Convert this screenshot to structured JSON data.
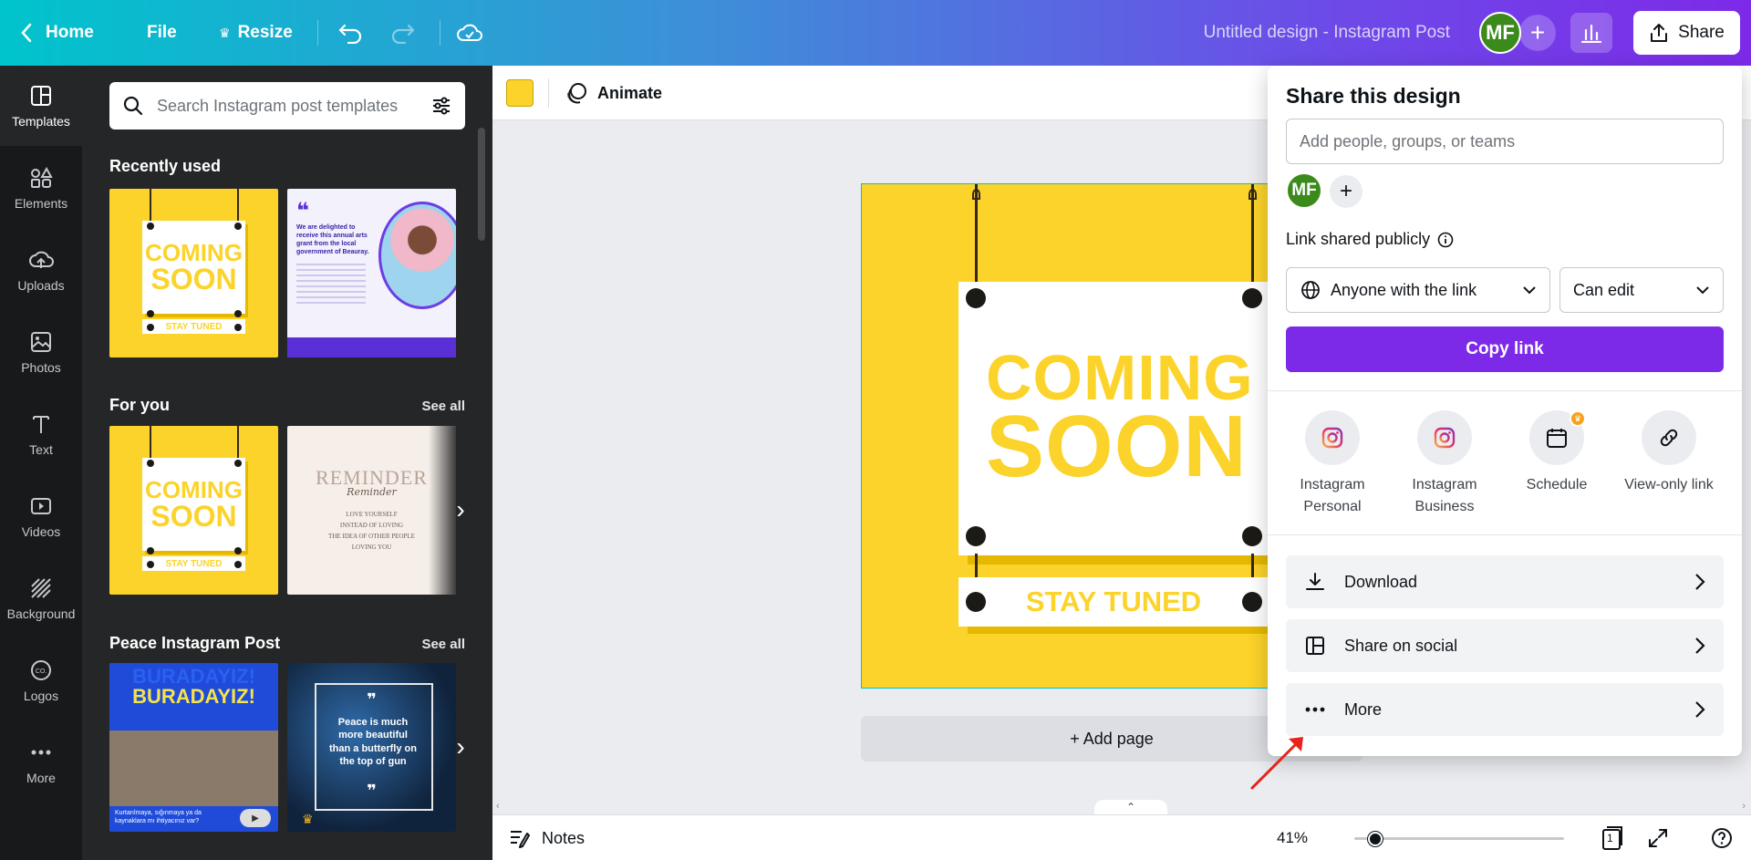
{
  "topbar": {
    "home": "Home",
    "file": "File",
    "resize": "Resize",
    "doc_title": "Untitled design - Instagram Post",
    "avatar_initials": "MF",
    "share": "Share"
  },
  "rail": {
    "items": [
      {
        "label": "Templates",
        "icon": "templates-icon"
      },
      {
        "label": "Elements",
        "icon": "elements-icon"
      },
      {
        "label": "Uploads",
        "icon": "upload-icon"
      },
      {
        "label": "Photos",
        "icon": "photo-icon"
      },
      {
        "label": "Text",
        "icon": "text-icon"
      },
      {
        "label": "Videos",
        "icon": "video-icon"
      },
      {
        "label": "Background",
        "icon": "background-icon"
      },
      {
        "label": "Logos",
        "icon": "logo-icon"
      },
      {
        "label": "More",
        "icon": "more-icon"
      }
    ]
  },
  "panel": {
    "search_placeholder": "Search Instagram post templates",
    "recently_used": "Recently used",
    "for_you": "For you",
    "peace": "Peace Instagram Post",
    "see_all": "See all",
    "thumb_cs": {
      "coming": "COMING",
      "soon": "SOON",
      "stay": "STAY TUNED"
    },
    "thumb_reminder": {
      "title": "REMINDER",
      "script": "Reminder",
      "lines": [
        "LOVE YOURSELF",
        "INSTEAD OF LOVING",
        "THE IDEA OF OTHER PEOPLE",
        "LOVING YOU"
      ]
    },
    "thumb_quote": {
      "text": "We are delighted to receive this annual arts grant from the local government of Beauray."
    },
    "thumb_burada": {
      "word": "BURADAYIZ!",
      "caption": "Kurtarılmaya, sığınmaya ya da kaynaklara mı ihtiyacınız var?"
    },
    "thumb_peace": {
      "text": "Peace is much more beautiful than a butterfly on the top of gun"
    }
  },
  "context_bar": {
    "color": "#fcd32a",
    "animate": "Animate"
  },
  "design": {
    "coming": "COMING",
    "soon": "SOON",
    "stay_tuned": "STAY TUNED",
    "bg_color": "#fcd32a"
  },
  "add_page": "+ Add page",
  "bottombar": {
    "notes": "Notes",
    "zoom": "41%",
    "zoom_level": 0.1,
    "page_count": "1"
  },
  "share_panel": {
    "title": "Share this design",
    "input_placeholder": "Add people, groups, or teams",
    "avatar_initials": "MF",
    "link_label": "Link shared publicly",
    "access": "Anyone with the link",
    "permission": "Can edit",
    "copy_link": "Copy link",
    "options": [
      {
        "label": "Instagram Personal",
        "icon": "instagram-icon"
      },
      {
        "label": "Instagram Business",
        "icon": "instagram-icon"
      },
      {
        "label": "Schedule",
        "icon": "calendar-icon"
      },
      {
        "label": "View-only link",
        "icon": "link-icon"
      }
    ],
    "rows": [
      {
        "label": "Download",
        "icon": "download-icon"
      },
      {
        "label": "Share on social",
        "icon": "share-social-icon"
      },
      {
        "label": "More",
        "icon": "more-dots-icon"
      }
    ]
  },
  "colors": {
    "brand_purple": "#7d2ae8",
    "accent_teal": "#00c4cc",
    "design_yellow": "#fcd32a"
  }
}
